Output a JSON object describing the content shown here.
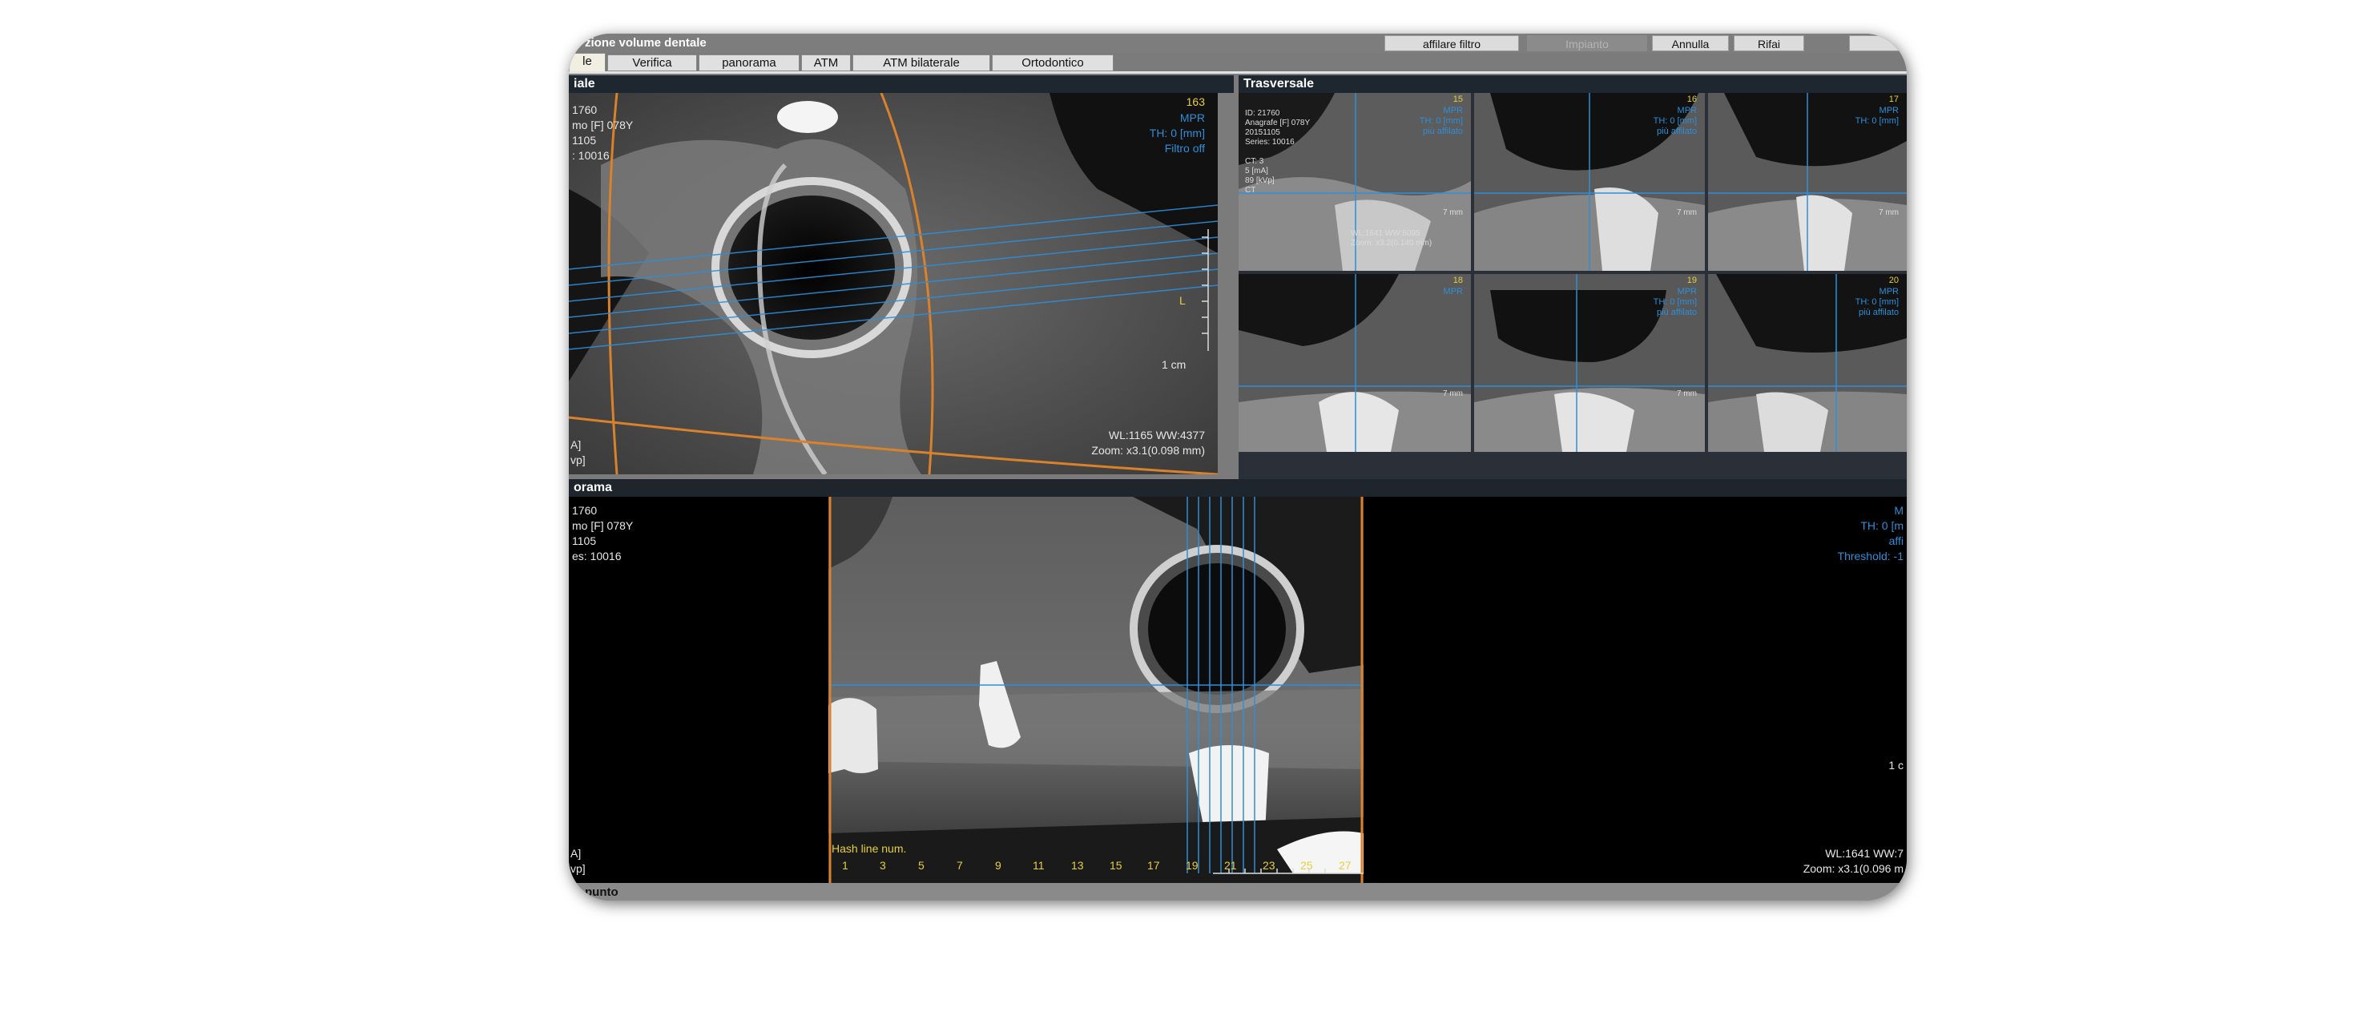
{
  "window": {
    "title": "zione volume dentale",
    "buttons": [
      {
        "label": "affilare filtro",
        "enabled": true
      },
      {
        "label": "Impianto",
        "enabled": false
      },
      {
        "label": "Annulla",
        "enabled": true
      },
      {
        "label": "Rifai",
        "enabled": true
      }
    ]
  },
  "tabs": [
    {
      "label": "le",
      "active": true
    },
    {
      "label": "Verifica",
      "active": false
    },
    {
      "label": "panorama",
      "active": false
    },
    {
      "label": "ATM",
      "active": false
    },
    {
      "label": "ATM bilaterale",
      "active": false
    },
    {
      "label": "Ortodontico",
      "active": false
    }
  ],
  "axial": {
    "header": "iale",
    "info_left": "1760\nmo [F] 078Y\n1105\n: 10016",
    "slice_num": "163",
    "info_right": "MPR\nTH: 0 [mm]\nFiltro off",
    "marker_L": "L",
    "scale_label": "1 cm",
    "footer_right": "WL:1165 WW:4377\nZoom: x3.1(0.098 mm)",
    "footer_left": "A]\nvp]"
  },
  "transversal": {
    "header": "Trasversale",
    "cells": [
      {
        "num": "15",
        "info": "MPR\nTH: 0 [mm]\npiù affilato",
        "scale": "7 mm",
        "left_info": "ID: 21760\nAnagrafe [F] 078Y\n20151105\nSeries: 10016\n\nCT: 3\n5 [mA]\n89 [kVp]\nCT",
        "wl": "WL:1641 WW:6095\nZoom: x3.2(0.140 mm)"
      },
      {
        "num": "16",
        "info": "MPR\nTH: 0 [mm]\npiù affilato",
        "scale": "7 mm",
        "left_info": "",
        "wl": ""
      },
      {
        "num": "17",
        "info": "MPR\nTH: 0 [mm]",
        "scale": "7 mm",
        "left_info": "",
        "wl": ""
      },
      {
        "num": "18",
        "info": "MPR",
        "scale": "7 mm",
        "left_info": "",
        "wl": ""
      },
      {
        "num": "19",
        "info": "MPR\nTH: 0 [mm]\npiù affilato",
        "scale": "7 mm",
        "left_info": "",
        "wl": ""
      },
      {
        "num": "20",
        "info": "MPR\nTH: 0 [mm]\npiù affilato",
        "scale": "",
        "left_info": "",
        "wl": ""
      }
    ]
  },
  "panorama": {
    "header": "orama",
    "info_left": "1760\nmo [F] 078Y\n1105\nes: 10016",
    "footer_left": "A]\nvp]",
    "info_right": "M\nTH: 0 [m\naffi\nThreshold: -1",
    "scale_right": "1 c",
    "footer_right": "WL:1641 WW:7\nZoom: x3.1(0.096 m",
    "hash_label": "Hash line num.",
    "hash_numbers": [
      "1",
      "3",
      "5",
      "7",
      "9",
      "11",
      "13",
      "15",
      "17",
      "19",
      "21",
      "23",
      "25",
      "27"
    ]
  },
  "status": {
    "text": "punto"
  },
  "colors": {
    "accent_blue": "#2e8ed8",
    "orange_curve": "#d9822b",
    "yellow_text": "#e6cf3c"
  }
}
